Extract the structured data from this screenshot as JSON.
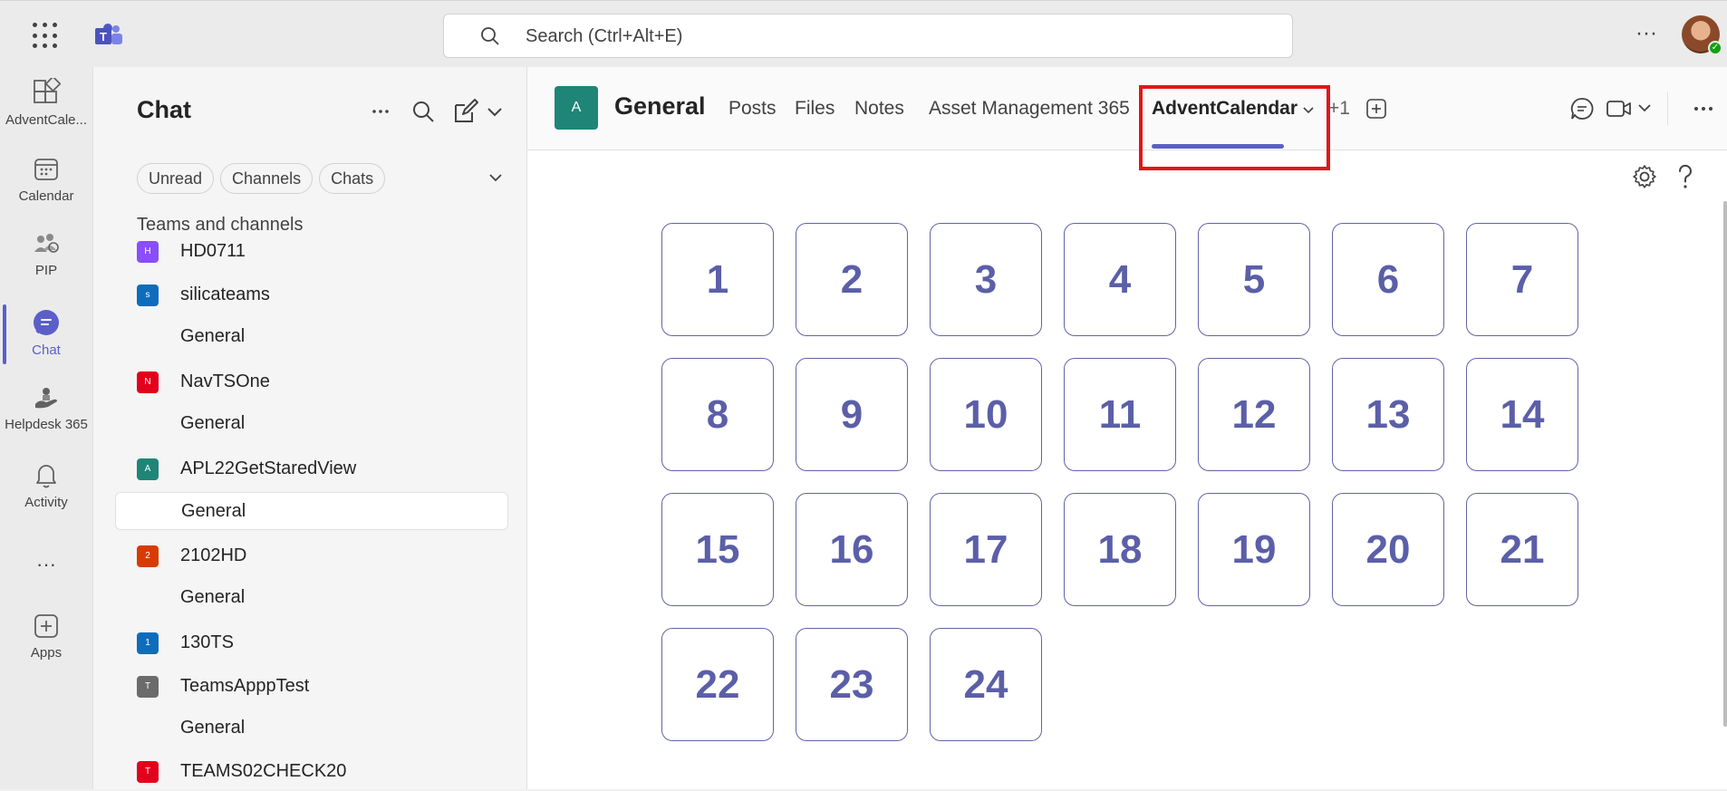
{
  "topbar": {
    "search_placeholder": "Search (Ctrl+Alt+E)",
    "more_label": "···"
  },
  "rail": {
    "items": [
      {
        "label": "AdventCale...",
        "icon": "app-grid-icon"
      },
      {
        "label": "Calendar",
        "icon": "calendar-icon"
      },
      {
        "label": "PIP",
        "icon": "pip-icon"
      },
      {
        "label": "Chat",
        "icon": "chat-icon",
        "active": true
      },
      {
        "label": "Helpdesk 365",
        "icon": "helpdesk-icon"
      },
      {
        "label": "Activity",
        "icon": "bell-icon"
      },
      {
        "label": "···",
        "icon": "more-icon"
      },
      {
        "label": "Apps",
        "icon": "apps-plus-icon"
      }
    ]
  },
  "chat": {
    "title": "Chat",
    "filters": [
      "Unread",
      "Channels",
      "Chats"
    ],
    "section_label": "Teams and channels",
    "tree": [
      {
        "type": "team",
        "name": "HD0711",
        "initial": "H",
        "color": "#8a4dff"
      },
      {
        "type": "team",
        "name": "silicateams",
        "initial": "s",
        "color": "#0f6cbd"
      },
      {
        "type": "channel",
        "name": "General"
      },
      {
        "type": "team",
        "name": "NavTSOne",
        "initial": "N",
        "color": "#e3001b"
      },
      {
        "type": "channel",
        "name": "General"
      },
      {
        "type": "team",
        "name": "APL22GetStaredView",
        "initial": "A",
        "color": "#1e8577"
      },
      {
        "type": "channel",
        "name": "General",
        "selected": true
      },
      {
        "type": "team",
        "name": "2102HD",
        "initial": "2",
        "color": "#d83b01"
      },
      {
        "type": "channel",
        "name": "General"
      },
      {
        "type": "team",
        "name": "130TS",
        "initial": "1",
        "color": "#0f6cbd"
      },
      {
        "type": "team",
        "name": "TeamsApppTest",
        "initial": "T",
        "color": "#6b6b6b"
      },
      {
        "type": "channel",
        "name": "General"
      },
      {
        "type": "team",
        "name": "TEAMS02CHECK20",
        "initial": "T",
        "color": "#e3001b"
      }
    ]
  },
  "header": {
    "team_initial": "A",
    "title": "General",
    "tabs": [
      "Posts",
      "Files",
      "Notes",
      "Asset Management 365",
      "AdventCalendar"
    ],
    "active_tab": "AdventCalendar",
    "overflow": "+1"
  },
  "calendar": {
    "days": [
      "1",
      "2",
      "3",
      "4",
      "5",
      "6",
      "7",
      "8",
      "9",
      "10",
      "11",
      "12",
      "13",
      "14",
      "15",
      "16",
      "17",
      "18",
      "19",
      "20",
      "21",
      "22",
      "23",
      "24"
    ]
  },
  "colors": {
    "accent": "#5b5fc7",
    "highlight": "#e0161b",
    "day_text": "#5b5fa8"
  }
}
